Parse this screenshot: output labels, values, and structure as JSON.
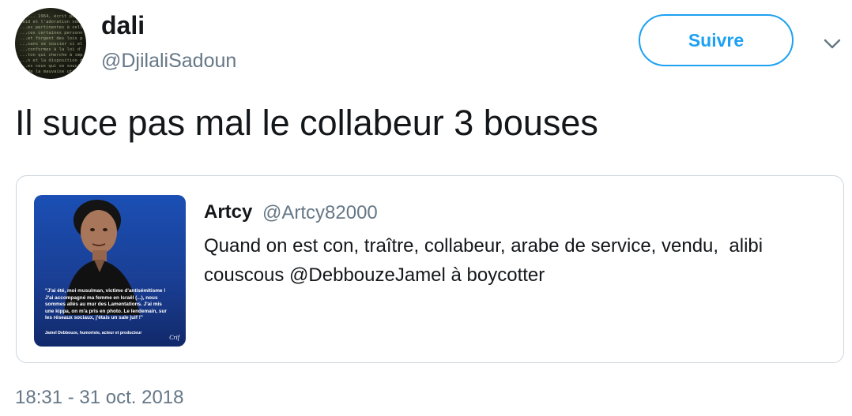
{
  "author": {
    "name": "dali",
    "handle": "@DjilaliSadoun",
    "avatar_icon": "avatar-image"
  },
  "follow_button": {
    "label": "Suivre",
    "color": "#1da1f2"
  },
  "menu": {
    "icon": "chevron-down-icon"
  },
  "tweet": {
    "text": "Il suce pas mal le collabeur 3 bouses",
    "timestamp": "18:31 - 31 oct. 2018"
  },
  "quoted_tweet": {
    "author_name": "Artcy",
    "author_handle": "@Artcy82000",
    "text_line1": "Quand on est con, traître, collabeur, arabe de service, vendu,  alibi",
    "text_line2": "couscous @DebbouzeJamel à boycotter",
    "media": {
      "caption_line1": "\"J'ai été, moi musulman, victime d'antisémitisme !",
      "caption_line2": "J'ai accompagné ma femme en Israël (...), nous",
      "caption_line3": "sommes allés au mur des Lamentations. J'ai mis",
      "caption_line4": "une kippa, on m'a pris en photo. Le lendemain, sur",
      "caption_line5": "les réseaux sociaux, j'étais un sale juif !\"",
      "credit": "Jamel Debbouze, humoriste, acteur et producteur",
      "watermark": "Crif"
    }
  }
}
